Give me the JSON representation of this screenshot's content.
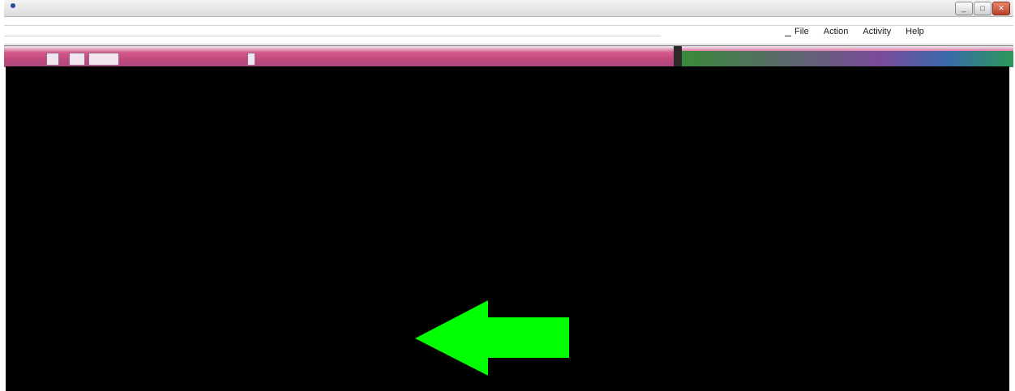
{
  "window": {
    "title_buttons": [
      "_",
      "□",
      "✕"
    ]
  },
  "menu": {
    "items": [
      "File",
      "Action",
      "Activity",
      "Help"
    ]
  },
  "colors": {
    "toolbar": "#c24a7a",
    "viewport": "#000000",
    "arrow": "#00ff00"
  },
  "icons": {
    "arrow": "arrow-left-icon"
  }
}
